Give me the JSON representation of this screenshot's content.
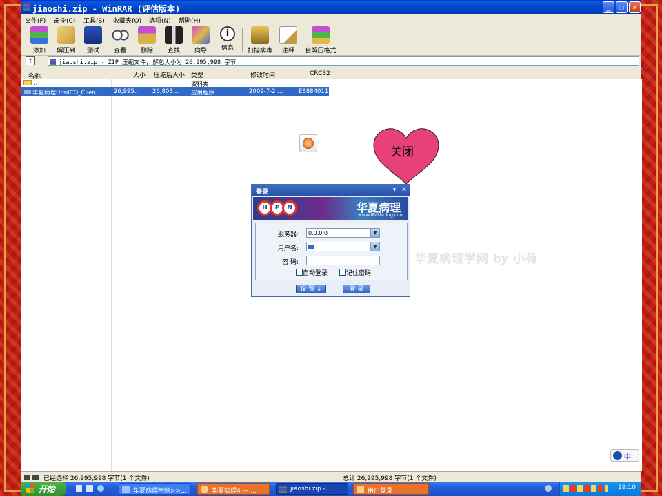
{
  "window": {
    "title": "jiaoshi.zip - WinRAR (评估版本)",
    "buttons": [
      "minimize",
      "maximize",
      "close"
    ]
  },
  "menu": [
    "文件(F)",
    "命令(C)",
    "工具(S)",
    "收藏夹(O)",
    "选项(N)",
    "帮助(H)"
  ],
  "toolbar": [
    {
      "label": "添加",
      "icon": "add-archive-icon"
    },
    {
      "label": "解压到",
      "icon": "extract-to-icon"
    },
    {
      "label": "测试",
      "icon": "test-icon"
    },
    {
      "label": "查看",
      "icon": "view-icon"
    },
    {
      "label": "删除",
      "icon": "delete-icon"
    },
    {
      "label": "查找",
      "icon": "find-icon"
    },
    {
      "label": "向导",
      "icon": "wizard-icon"
    },
    {
      "label": "信息",
      "icon": "info-icon"
    },
    {
      "label": "扫描病毒",
      "icon": "virus-scan-icon"
    },
    {
      "label": "注释",
      "icon": "comment-icon"
    },
    {
      "label": "自解压格式",
      "icon": "sfx-icon"
    }
  ],
  "address": "jiaoshi.zip - ZIP 压缩文件, 解包大小为 26,995,998 字节",
  "columns": [
    "名称",
    "大小",
    "压缩后大小",
    "类型",
    "修改时间",
    "CRC32"
  ],
  "files": [
    {
      "name": "..",
      "size": "",
      "packed": "",
      "type": "资料夹",
      "modified": "",
      "crc": ""
    },
    {
      "name": "华夏病理HpnICQ_Clien...",
      "size": "26,995...",
      "packed": "26,803...",
      "type": "应用程序",
      "modified": "2009-7-2 ...",
      "crc": "E8884011"
    }
  ],
  "status": {
    "left": "已经选择 26,995,998 字节(1 个文件)",
    "right": "总计 26,995,998 字节(1 个文件)"
  },
  "annotations": {
    "heart_top": "关闭",
    "heart_mid": "关闭",
    "watermark": "华夏病理学网 by 小荷"
  },
  "login": {
    "title": "登录",
    "brand": "华夏病理",
    "url": "www.iPathology.cn",
    "logo_letters": [
      "H",
      "P",
      "N"
    ],
    "server_label": "服务器:",
    "server_value": "0.0.0.0",
    "user_label": "用户名:",
    "user_value": "",
    "password_label": "密  码:",
    "auto_login": "自动登录",
    "remember": "记住密码",
    "settings_btn": "设 置 ↓",
    "login_btn": "登 录"
  },
  "ime": "中",
  "taskbar": {
    "start": "开始",
    "tasks": [
      "华夏病理学网>>...",
      "华夏病理4 — ...",
      "jiaoshi.zip -...",
      "用户登录"
    ],
    "clock": "19:10"
  }
}
